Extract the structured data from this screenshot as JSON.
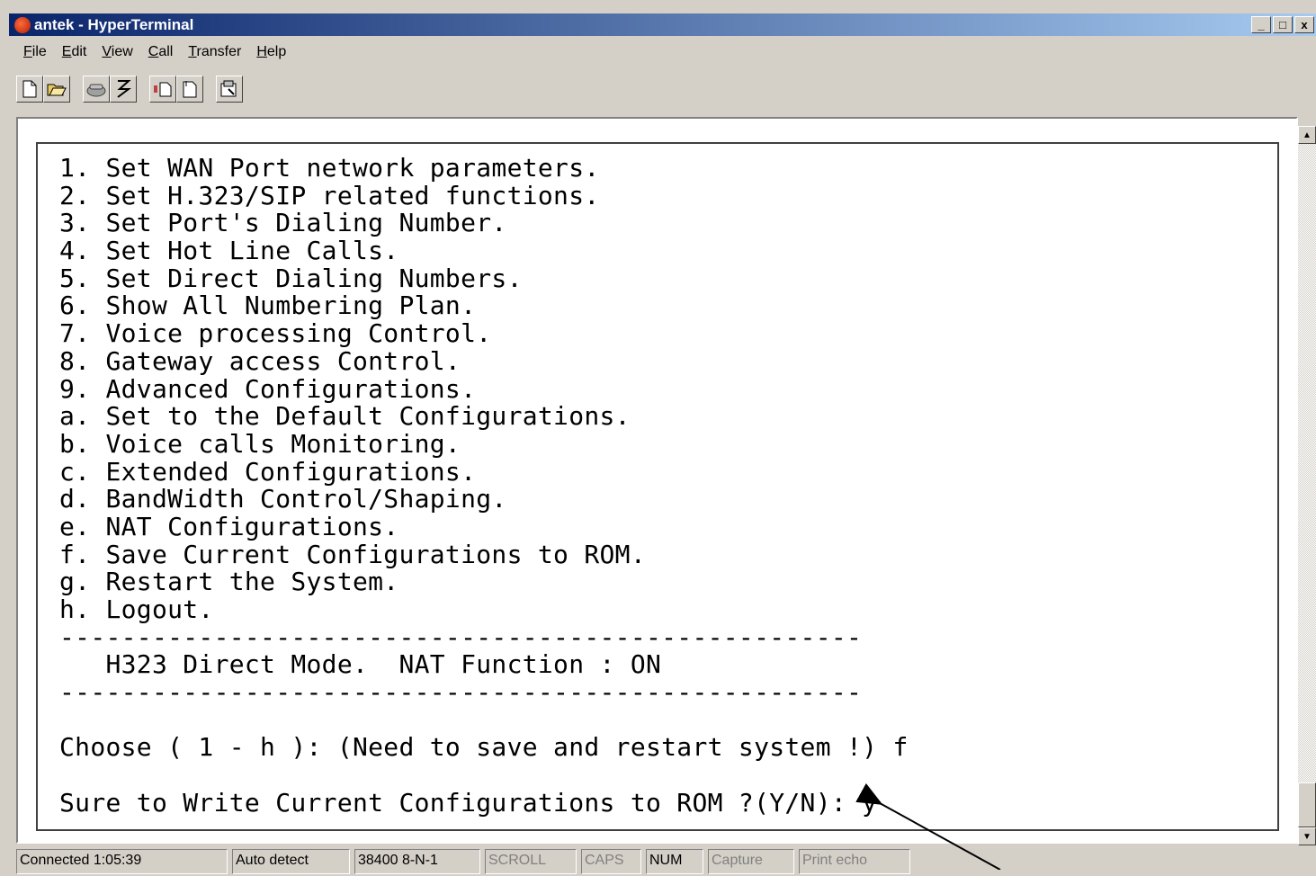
{
  "window": {
    "title": "antek - HyperTerminal",
    "minimize": "_",
    "maximize": "□",
    "close": "x"
  },
  "menu": [
    "File",
    "Edit",
    "View",
    "Call",
    "Transfer",
    "Help"
  ],
  "menu_accels": [
    "F",
    "E",
    "V",
    "C",
    "T",
    "H"
  ],
  "toolbar": {
    "icons": [
      "new-icon",
      "open-icon",
      "connect-icon",
      "disconnect-icon",
      "send-icon",
      "receive-icon",
      "properties-icon"
    ]
  },
  "terminal": {
    "lines": [
      "1. Set WAN Port network parameters.",
      "2. Set H.323/SIP related functions.",
      "3. Set Port's Dialing Number.",
      "4. Set Hot Line Calls.",
      "5. Set Direct Dialing Numbers.",
      "6. Show All Numbering Plan.",
      "7. Voice processing Control.",
      "8. Gateway access Control.",
      "9. Advanced Configurations.",
      "a. Set to the Default Configurations.",
      "b. Voice calls Monitoring.",
      "c. Extended Configurations.",
      "d. BandWidth Control/Shaping.",
      "e. NAT Configurations.",
      "f. Save Current Configurations to ROM.",
      "g. Restart the System.",
      "h. Logout.",
      "----------------------------------------------------",
      "   H323 Direct Mode.  NAT Function : ON",
      "----------------------------------------------------",
      "",
      "Choose ( 1 - h ): (Need to save and restart system !) f",
      "",
      "Sure to Write Current Configurations to ROM ?(Y/N): y"
    ]
  },
  "status": {
    "connected": "Connected 1:05:39",
    "detect": "Auto detect",
    "port": "38400 8-N-1",
    "scroll": "SCROLL",
    "caps": "CAPS",
    "num": "NUM",
    "capture": "Capture",
    "print_echo": "Print echo"
  }
}
